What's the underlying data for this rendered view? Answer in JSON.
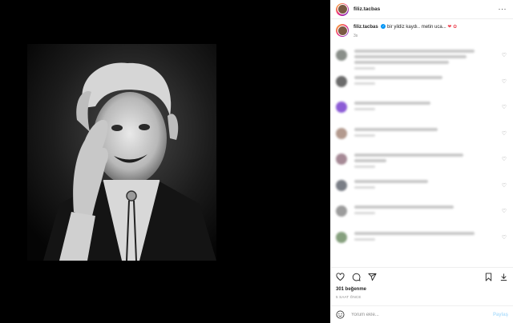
{
  "post": {
    "username": "filiz.tacbas",
    "caption": "bir yildiz kaydı.. metin uca...",
    "caption_time": "3s",
    "likes": "301 beğenme",
    "time_ago": "5 SAAT ÖNCE"
  },
  "add_comment": {
    "placeholder": "Yorum ekle...",
    "post_label": "Paylaş"
  },
  "icons": {
    "more": "more-dots-icon",
    "verified": "verified-badge-icon",
    "like": "heart-icon",
    "comment": "comment-icon",
    "share": "send-icon",
    "save": "bookmark-icon",
    "download": "download-icon",
    "emoji": "emoji-icon"
  },
  "colors": {
    "verified_blue": "#0095f6",
    "heart_red": "#ed4956",
    "muted": "#8e8e8e",
    "post_button_disabled": "#b2dffc"
  }
}
